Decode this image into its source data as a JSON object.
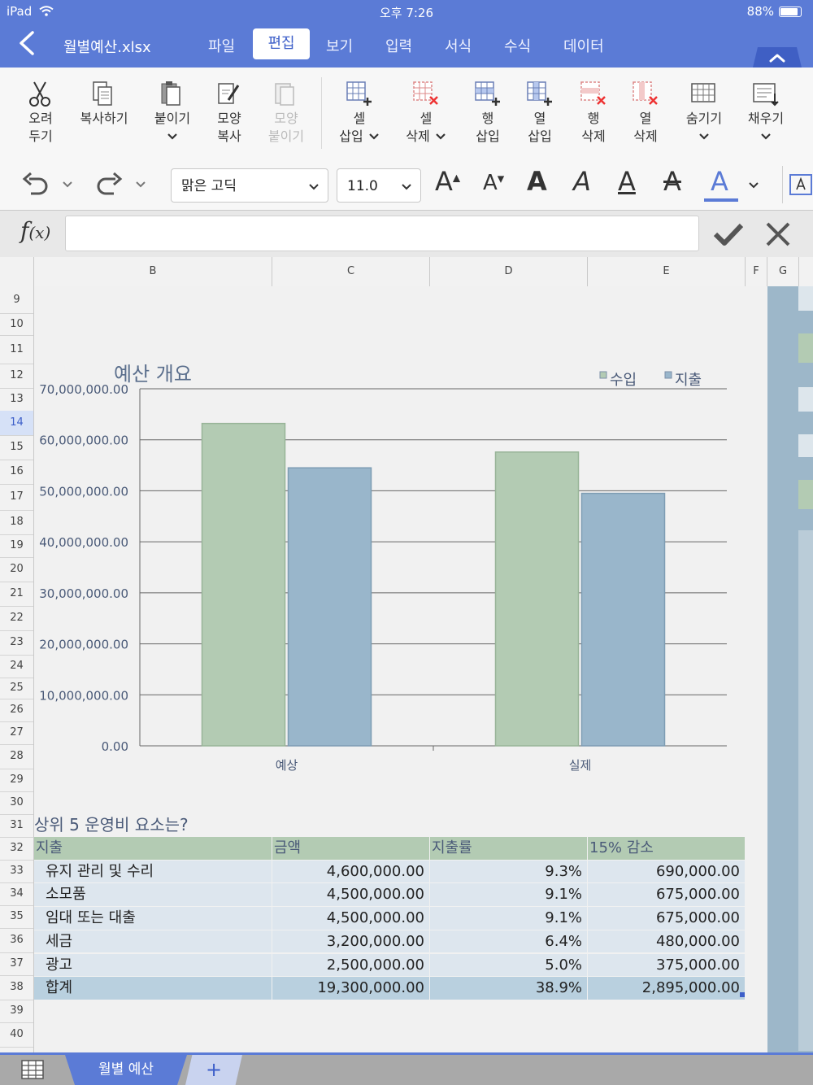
{
  "status": {
    "device": "iPad",
    "time": "오후 7:26",
    "battery": "88%"
  },
  "title_bar": {
    "file_name": "월별예산.xlsx"
  },
  "menu_tabs": [
    {
      "label": "파일",
      "active": false
    },
    {
      "label": "편집",
      "active": true
    },
    {
      "label": "보기",
      "active": false
    },
    {
      "label": "입력",
      "active": false
    },
    {
      "label": "서식",
      "active": false
    },
    {
      "label": "수식",
      "active": false
    },
    {
      "label": "데이터",
      "active": false
    }
  ],
  "ribbon": [
    {
      "l1": "오려",
      "l2": "두기",
      "icon": "scissors-icon",
      "enabled": true,
      "chevron": false
    },
    {
      "l1": "복사하기",
      "l2": "",
      "icon": "copy-icon",
      "enabled": true,
      "chevron": false
    },
    {
      "l1": "붙이기",
      "l2": "",
      "icon": "paste-icon",
      "enabled": true,
      "chevron": true
    },
    {
      "l1": "모양",
      "l2": "복사",
      "icon": "format-painter-icon",
      "enabled": true,
      "chevron": false
    },
    {
      "l1": "모양",
      "l2": "붙이기",
      "icon": "format-paste-icon",
      "enabled": false,
      "chevron": false
    },
    {
      "l1": "셀",
      "l2": "삽입",
      "icon": "insert-cell-icon",
      "enabled": true,
      "chevron": true
    },
    {
      "l1": "셀",
      "l2": "삭제",
      "icon": "delete-cell-icon",
      "enabled": true,
      "chevron": true
    },
    {
      "l1": "행",
      "l2": "삽입",
      "icon": "insert-row-icon",
      "enabled": true,
      "chevron": false
    },
    {
      "l1": "열",
      "l2": "삽입",
      "icon": "insert-column-icon",
      "enabled": true,
      "chevron": false
    },
    {
      "l1": "행",
      "l2": "삭제",
      "icon": "delete-row-icon",
      "enabled": true,
      "chevron": false
    },
    {
      "l1": "열",
      "l2": "삭제",
      "icon": "delete-column-icon",
      "enabled": true,
      "chevron": false
    },
    {
      "l1": "숨기기",
      "l2": "",
      "icon": "hide-icon",
      "enabled": true,
      "chevron": true
    },
    {
      "l1": "채우기",
      "l2": "",
      "icon": "fill-icon",
      "enabled": true,
      "chevron": true
    }
  ],
  "font_row": {
    "font_name": "맑은 고딕",
    "font_size": "11.0",
    "grow_glyph": "A",
    "shrink_glyph": "A",
    "bold_glyph": "A",
    "italic_glyph": "A",
    "underline_glyph": "A",
    "strike_glyph": "A",
    "color_glyph": "A",
    "color_bar": "#5b7bd6"
  },
  "formula": {
    "value": ""
  },
  "columns": [
    "B",
    "C",
    "D",
    "E",
    "F",
    "G"
  ],
  "rows": [
    "9",
    "10",
    "11",
    "12",
    "13",
    "14",
    "15",
    "16",
    "17",
    "18",
    "19",
    "20",
    "21",
    "22",
    "23",
    "24",
    "25",
    "26",
    "27",
    "28",
    "29",
    "30",
    "31",
    "32",
    "33",
    "34",
    "35",
    "36",
    "37",
    "38",
    "39",
    "40"
  ],
  "selected_row": "14",
  "chart_data": {
    "type": "bar",
    "title": "예산 개요",
    "categories": [
      "예상",
      "실제"
    ],
    "series": [
      {
        "name": "수입",
        "color": "#b3cbb3",
        "values": [
          63200000,
          57600000
        ]
      },
      {
        "name": "지출",
        "color": "#99b6cb",
        "values": [
          54500000,
          49500000
        ]
      }
    ],
    "ylim": [
      0,
      70000000
    ],
    "yticks": [
      "70,000,000.00",
      "60,000,000.00",
      "50,000,000.00",
      "40,000,000.00",
      "30,000,000.00",
      "20,000,000.00",
      "10,000,000.00",
      "0.00"
    ],
    "legend": "top-right",
    "grid": true
  },
  "table": {
    "question": "상위 5 운영비 요소는?",
    "headers": [
      "지출",
      "금액",
      "지출률",
      "15% 감소"
    ],
    "rows": [
      [
        "유지 관리 및 수리",
        "4,600,000.00",
        "9.3%",
        "690,000.00"
      ],
      [
        "소모품",
        "4,500,000.00",
        "9.1%",
        "675,000.00"
      ],
      [
        "임대 또는 대출",
        "4,500,000.00",
        "9.1%",
        "675,000.00"
      ],
      [
        "세금",
        "3,200,000.00",
        "6.4%",
        "480,000.00"
      ],
      [
        "광고",
        "2,500,000.00",
        "5.0%",
        "375,000.00"
      ]
    ],
    "total": [
      "합계",
      "19,300,000.00",
      "38.9%",
      "2,895,000.00"
    ]
  },
  "sheet_tabs": {
    "active": "월별 예산",
    "add_label": "+"
  }
}
